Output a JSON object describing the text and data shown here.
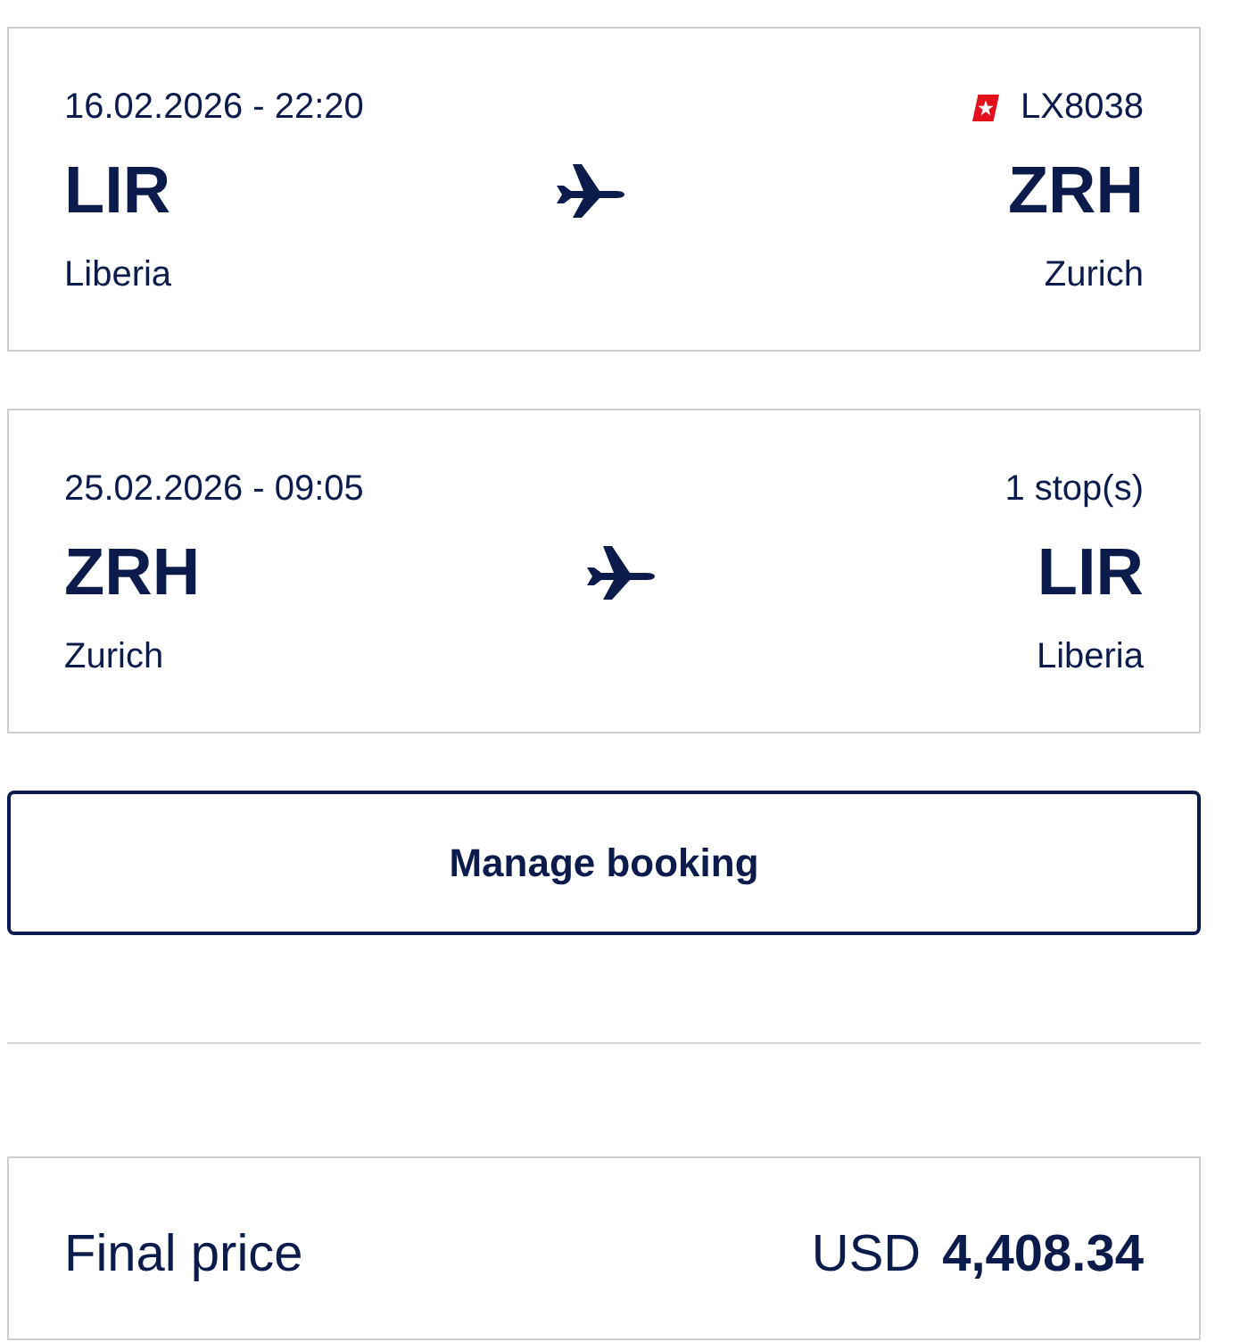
{
  "flights": [
    {
      "datetime": "16.02.2026 - 22:20",
      "info": {
        "kind": "airline",
        "text": "LX8038"
      },
      "from": {
        "code": "LIR",
        "city": "Liberia"
      },
      "to": {
        "code": "ZRH",
        "city": "Zurich"
      }
    },
    {
      "datetime": "25.02.2026 - 09:05",
      "info": {
        "kind": "stops",
        "text": "1 stop(s)"
      },
      "from": {
        "code": "ZRH",
        "city": "Zurich"
      },
      "to": {
        "code": "LIR",
        "city": "Liberia"
      }
    }
  ],
  "manage_button": "Manage booking",
  "price": {
    "label": "Final price",
    "currency": "USD",
    "amount": "4,408.34"
  }
}
